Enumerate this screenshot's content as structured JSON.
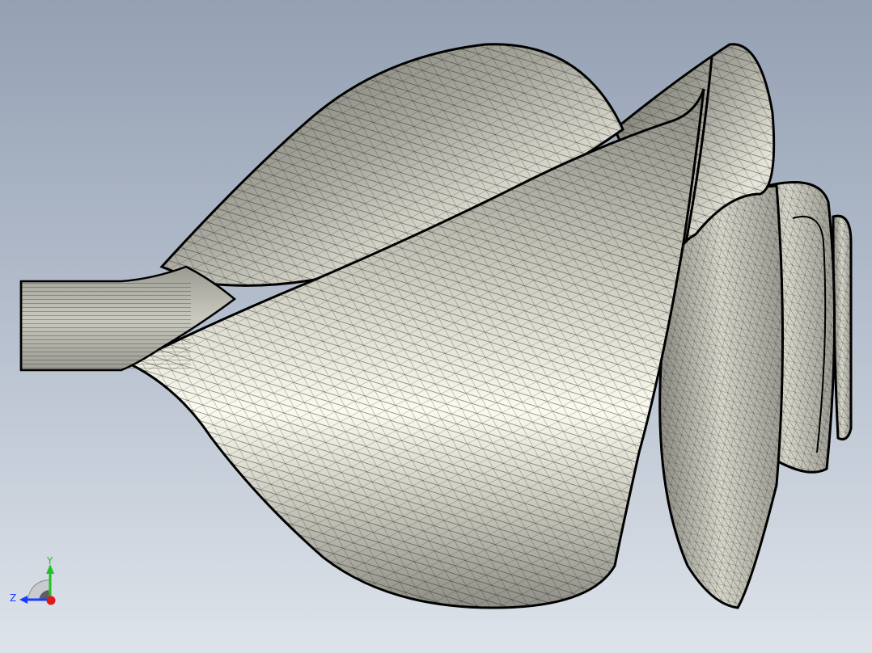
{
  "viewport": {
    "background_top": "#94a1b3",
    "background_bottom": "#dee3ea",
    "model": {
      "name": "swept-blade-surface-mesh",
      "render_mode": "shaded-with-edges",
      "surface_color": "#b8b8ae",
      "highlight_color": "#f4f4e6",
      "edge_color": "#000000"
    }
  },
  "triad": {
    "y_label": "Y",
    "z_label": "Z",
    "y_color": "#22c022",
    "z_color": "#1a3cff",
    "x_color": "#e01818"
  }
}
